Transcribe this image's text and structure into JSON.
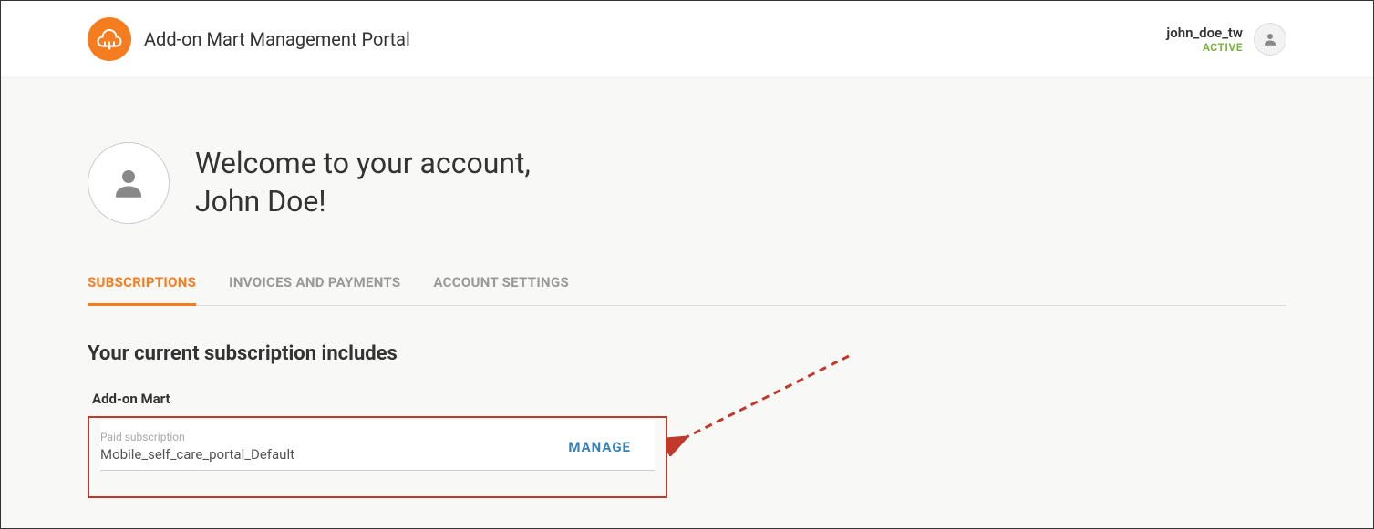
{
  "header": {
    "title": "Add-on Mart Management Portal",
    "username": "john_doe_tw",
    "status": "ACTIVE"
  },
  "welcome": {
    "line1": "Welcome to your account,",
    "line2": "John Doe!"
  },
  "tabs": {
    "subscriptions": "SUBSCRIPTIONS",
    "invoices": "INVOICES AND PAYMENTS",
    "settings": "ACCOUNT SETTINGS"
  },
  "section": {
    "heading": "Your current subscription includes",
    "group": "Add-on Mart"
  },
  "subscription": {
    "type": "Paid subscription",
    "name": "Mobile_self_care_portal_Default",
    "manage": "MANAGE"
  },
  "colors": {
    "accent": "#f57c1f",
    "status_active": "#7cb342",
    "link": "#3a7fb5",
    "highlight": "#c0392b"
  }
}
